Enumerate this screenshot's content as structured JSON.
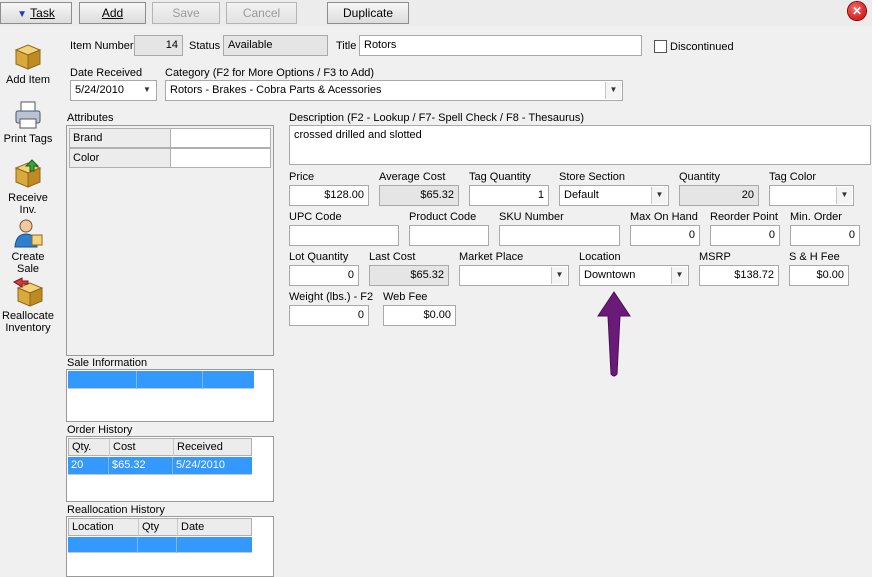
{
  "toolbar": {
    "task_label": "Task",
    "add_label": "Add",
    "save_label": "Save",
    "cancel_label": "Cancel",
    "duplicate_label": "Duplicate"
  },
  "sidebar": {
    "items": [
      {
        "label": "Add Item"
      },
      {
        "label": "Print Tags"
      },
      {
        "label": "Receive Inv."
      },
      {
        "label": "Create Sale"
      },
      {
        "label": "Reallocate Inventory"
      }
    ]
  },
  "item": {
    "number_label": "Item Number",
    "number": "14",
    "status_label": "Status",
    "status": "Available",
    "title_label": "Title",
    "title": "Rotors",
    "discontinued_label": "Discontinued",
    "date_label": "Date Received",
    "date": "5/24/2010",
    "category_label": "Category (F2 for More Options / F3 to Add)",
    "category": "Rotors - Brakes - Cobra Parts & Acessories"
  },
  "attributes": {
    "label": "Attributes",
    "rows": [
      {
        "name": "Brand",
        "value": ""
      },
      {
        "name": "Color",
        "value": ""
      }
    ]
  },
  "description": {
    "label": "Description  (F2 - Lookup / F7- Spell Check / F8 - Thesaurus)",
    "value": "crossed drilled and slotted"
  },
  "fields": {
    "price_label": "Price",
    "price": "$128.00",
    "avg_cost_label": "Average Cost",
    "avg_cost": "$65.32",
    "tag_qty_label": "Tag Quantity",
    "tag_qty": "1",
    "store_section_label": "Store Section",
    "store_section": "Default",
    "quantity_label": "Quantity",
    "quantity": "20",
    "tag_color_label": "Tag Color",
    "tag_color": "",
    "upc_label": "UPC Code",
    "upc": "",
    "product_code_label": "Product Code",
    "product_code": "",
    "sku_label": "SKU Number",
    "sku": "",
    "max_on_hand_label": "Max On Hand",
    "max_on_hand": "0",
    "reorder_label": "Reorder Point",
    "reorder": "0",
    "min_order_label": "Min. Order",
    "min_order": "0",
    "lot_qty_label": "Lot Quantity",
    "lot_qty": "0",
    "last_cost_label": "Last Cost",
    "last_cost": "$65.32",
    "market_place_label": "Market Place",
    "market_place": "",
    "location_label": "Location",
    "location": "Downtown",
    "msrp_label": "MSRP",
    "msrp": "$138.72",
    "sh_fee_label": "S & H Fee",
    "sh_fee": "$0.00",
    "weight_label": "Weight (lbs.) - F2",
    "weight": "0",
    "web_fee_label": "Web Fee",
    "web_fee": "$0.00"
  },
  "sale_info": {
    "label": "Sale Information"
  },
  "order_history": {
    "label": "Order History",
    "columns": [
      "Qty.",
      "Cost",
      "Received"
    ],
    "rows": [
      [
        "20",
        "$65.32",
        "5/24/2010"
      ]
    ]
  },
  "reallocation_history": {
    "label": "Reallocation History",
    "columns": [
      "Location",
      "Qty",
      "Date"
    ]
  },
  "colors": {
    "selection": "#3399ff",
    "arrow": "#6a1b7a"
  },
  "icons": [
    "box-icon",
    "printer-icon",
    "receive-box-icon",
    "person-sale-icon",
    "reallocate-icon",
    "close-icon"
  ]
}
